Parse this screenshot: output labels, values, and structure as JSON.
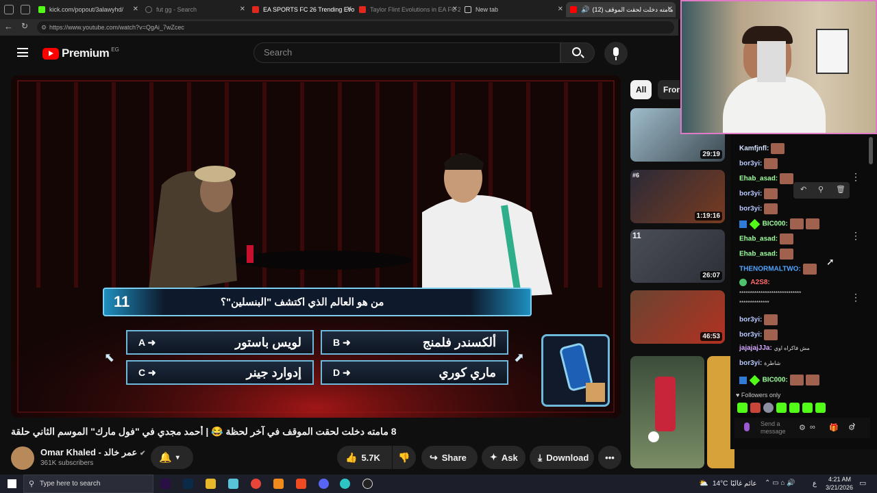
{
  "tabs": [
    {
      "title": "kick.com/popout/3alawyhd/",
      "color": "#53fc18"
    },
    {
      "title": "fut gg - Search",
      "color": "#444444"
    },
    {
      "title": "EA SPORTS FC 26 Trending Evolu",
      "color": "#e0281e"
    },
    {
      "title": "Taylor Flint Evolutions in EA FC 2",
      "color": "#e0281e"
    },
    {
      "title": "New tab",
      "color": "#cccccc"
    },
    {
      "title": "(12) مامته دخلت لحقت الموقف",
      "color": "#ff0000"
    }
  ],
  "url": "https://www.youtube.com/watch?v=QgAi_7wZcec",
  "yt": {
    "logo": "Premium",
    "region": "EG",
    "search_placeholder": "Search"
  },
  "quiz": {
    "number": "11",
    "question": "من هو العالم الذي اكتشف \"البنسلين\"؟",
    "a_letter": "A",
    "a_text": "لويس باستور",
    "b_letter": "B",
    "b_text": "ألكسندر فلمنج",
    "c_letter": "C",
    "c_text": "إدوارد جينر",
    "d_letter": "D",
    "d_text": "ماري كوري"
  },
  "video": {
    "title": "8 مامته دخلت لحقت الموقف في آخر لحظة 😂 | أحمد مجدي في \"فول مارك\" الموسم الثاني حلقة",
    "channel": "Omar Khaled - عمر خالد",
    "subscribers": "361K subscribers",
    "likes": "5.7K",
    "share": "Share",
    "ask": "Ask",
    "download": "Download"
  },
  "chips": [
    "All",
    "From"
  ],
  "thumbs": [
    {
      "duration": "29:19",
      "tag": "",
      "color": "#8aa6b5"
    },
    {
      "duration": "1:19:16",
      "tag": "#6",
      "color": "#3a3540"
    },
    {
      "duration": "26:07",
      "tag": "11",
      "color": "#4a4e57"
    },
    {
      "duration": "46:53",
      "tag": "",
      "color": "#5a3b2d"
    }
  ],
  "chat": {
    "messages": [
      {
        "user": "Kamfjnfl:",
        "color": "#d6e2ff",
        "text": "",
        "emotes": 1
      },
      {
        "user": "bor3yi:",
        "color": "#b8c9ff",
        "text": "",
        "emotes": 1
      },
      {
        "user": "Ehab_asad:",
        "color": "#9bff9b",
        "text": "",
        "emotes": 1
      },
      {
        "user": "bor3yi:",
        "color": "#b8c9ff",
        "text": "",
        "emotes": 1
      },
      {
        "user": "bor3yi:",
        "color": "#b8c9ff",
        "text": "",
        "emotes": 1
      },
      {
        "user": "BIC000:",
        "color": "#9bff9b",
        "text": "",
        "emotes": 2
      },
      {
        "user": "Ehab_asad:",
        "color": "#9bff9b",
        "text": "",
        "emotes": 1
      },
      {
        "user": "Ehab_asad:",
        "color": "#9bff9b",
        "text": "",
        "emotes": 1
      },
      {
        "user": "THENORMALTWO:",
        "color": "#4fa3ff",
        "text": "",
        "emotes": 1
      },
      {
        "user": "A2S8:",
        "color": "#ff6b6b",
        "text": "",
        "emotes": 0
      },
      {
        "user": "bor3yi:",
        "color": "#b8c9ff",
        "text": "",
        "emotes": 1
      },
      {
        "user": "bor3yi:",
        "color": "#b8c9ff",
        "text": "",
        "emotes": 1
      },
      {
        "user": "jajajajJJa:",
        "color": "#d6a8ff",
        "text": "مش فاكراه اوي",
        "emotes": 0
      },
      {
        "user": "bor3yi:",
        "color": "#b8c9ff",
        "text": "شاطرة",
        "emotes": 0
      },
      {
        "user": "BIC000:",
        "color": "#9bff9b",
        "text": "",
        "emotes": 2
      }
    ],
    "spam_line_1": "*****************************",
    "spam_line_2": "**************",
    "followers_only": "Followers only",
    "send_placeholder": "Send a message"
  },
  "taskbar": {
    "search_placeholder": "Type here to search",
    "weather": "14°C",
    "weather_text": "عائم غالبًا",
    "lang": "ع",
    "time": "4:21 AM",
    "date": "3/21/2026"
  }
}
